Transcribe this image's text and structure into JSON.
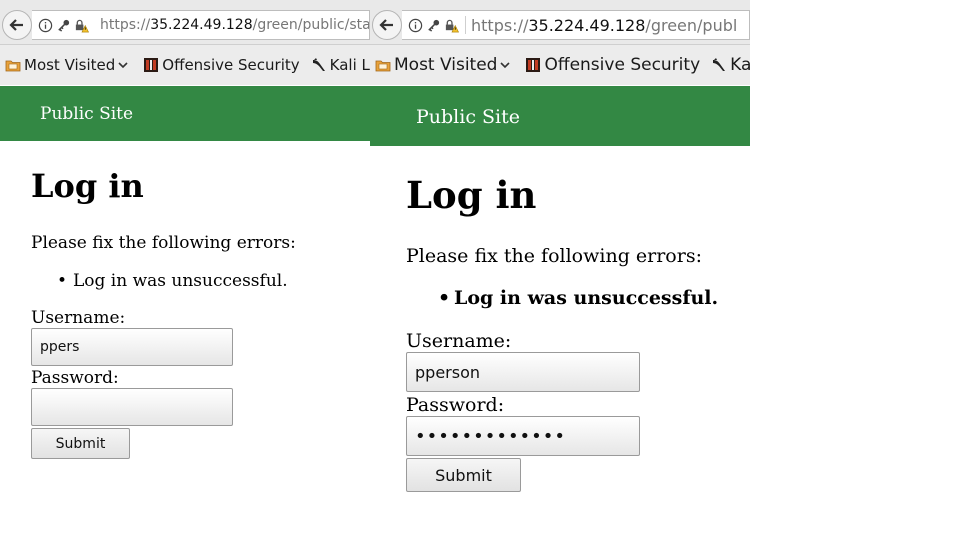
{
  "colors": {
    "header_green": "#338844",
    "header_text": "#ffffff"
  },
  "left": {
    "url": {
      "scheme": "https://",
      "host": "35.224.49.128",
      "path": "/green/public/stat"
    },
    "bookmarks": [
      {
        "label": "Most Visited",
        "icon": "folder-icon",
        "dropdown": true
      },
      {
        "label": "Offensive Security",
        "icon": "offsec-icon"
      },
      {
        "label": "Kali Linux",
        "icon": "kali-dragon-icon"
      }
    ],
    "site_name": "Public Site",
    "title": "Log in",
    "error_intro": "Please fix the following errors:",
    "errors": [
      "Log in was unsuccessful."
    ],
    "username_label": "Username:",
    "username_value": "ppers",
    "password_label": "Password:",
    "password_value": "",
    "submit_label": "Submit"
  },
  "right": {
    "url": {
      "scheme": "https://",
      "host": "35.224.49.128",
      "path": "/green/publ"
    },
    "bookmarks": [
      {
        "label": "Most Visited",
        "icon": "folder-icon",
        "dropdown": true
      },
      {
        "label": "Offensive Security",
        "icon": "offsec-icon"
      },
      {
        "label": "Kali",
        "icon": "kali-dragon-icon"
      }
    ],
    "site_name": "Public Site",
    "title": "Log in",
    "error_intro": "Please fix the following errors:",
    "errors": [
      "Log in was unsuccessful."
    ],
    "username_label": "Username:",
    "username_value": "pperson",
    "password_label": "Password:",
    "password_masked": "•••••••••••••",
    "submit_label": "Submit"
  }
}
